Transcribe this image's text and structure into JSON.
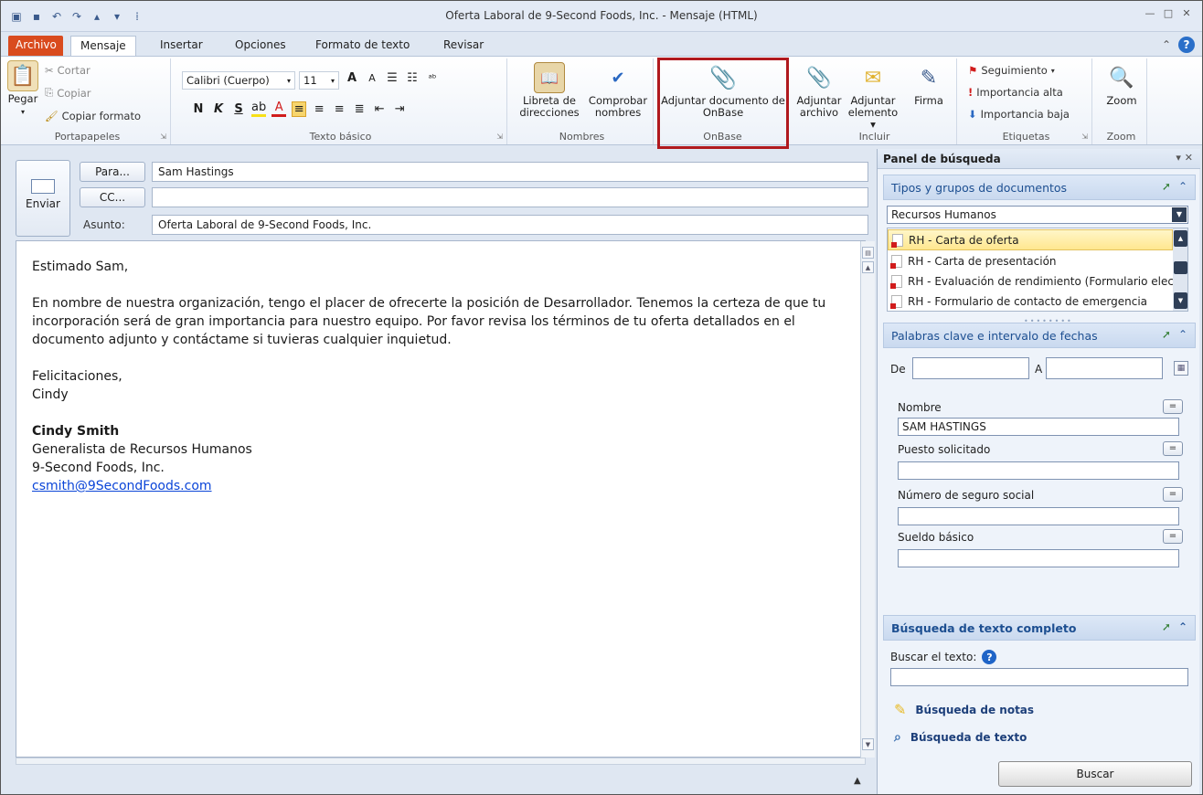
{
  "window": {
    "title": "Oferta Laboral de 9-Second Foods, Inc. - Mensaje (HTML)"
  },
  "tabs": [
    {
      "label": "Archivo"
    },
    {
      "label": "Mensaje"
    },
    {
      "label": "Insertar"
    },
    {
      "label": "Opciones"
    },
    {
      "label": "Formato de texto"
    },
    {
      "label": "Revisar"
    }
  ],
  "ribbon": {
    "portapapeles": {
      "label": "Portapapeles",
      "paste": "Pegar",
      "cut": "Cortar",
      "copy": "Copiar",
      "format_painter": "Copiar formato"
    },
    "texto_basico": {
      "label": "Texto básico",
      "font": "Calibri (Cuerpo)",
      "size": "11",
      "bold": "N",
      "italic": "K",
      "underline": "S"
    },
    "nombres": {
      "label": "Nombres",
      "address_book": "Libreta de direcciones",
      "check_names": "Comprobar nombres"
    },
    "onbase": {
      "label": "OnBase",
      "attach": "Adjuntar documento de OnBase"
    },
    "incluir": {
      "label": "Incluir",
      "attach_file": "Adjuntar archivo",
      "attach_item": "Adjuntar elemento",
      "signature": "Firma"
    },
    "etiquetas": {
      "label": "Etiquetas",
      "followup": "Seguimiento",
      "high": "Importancia alta",
      "low": "Importancia baja"
    },
    "zoom": {
      "label": "Zoom",
      "button": "Zoom"
    }
  },
  "compose": {
    "send": "Enviar",
    "to_button": "Para...",
    "to_value": "Sam Hastings",
    "cc_button": "CC...",
    "cc_value": "",
    "subject_label": "Asunto:",
    "subject_value": "Oferta Laboral de 9-Second Foods, Inc.",
    "body": {
      "greeting": "Estimado Sam,",
      "paragraph": "En nombre de nuestra organización, tengo el placer de ofrecerte la posición de Desarrollador. Tenemos la certeza de que tu incorporación será de gran importancia para nuestro equipo. Por favor revisa los términos de tu oferta detallados en el documento adjunto y contáctame si tuvieras cualquier inquietud.",
      "closing": "Felicitaciones,",
      "closing_name": "Cindy",
      "sig_name": "Cindy Smith",
      "sig_title": "Generalista de Recursos Humanos",
      "sig_company": "9-Second Foods, Inc.",
      "sig_email": "csmith@9SecondFoods.com"
    }
  },
  "panel": {
    "title": "Panel de búsqueda",
    "doc_types_section": "Tipos y grupos de documentos",
    "doc_group": "Recursos Humanos",
    "documents": [
      {
        "label": "RH - Carta de oferta",
        "selected": true
      },
      {
        "label": "RH - Carta de presentación",
        "selected": false
      },
      {
        "label": "RH - Evaluación de rendimiento (Formulario elec",
        "selected": false
      },
      {
        "label": "RH - Formulario de contacto de emergencia",
        "selected": false
      }
    ],
    "keywords_section": "Palabras clave e intervalo de fechas",
    "from_label": "De",
    "to_label": "A",
    "from_value": "",
    "to_value": "",
    "fields": [
      {
        "label": "Nombre",
        "value": "SAM HASTINGS"
      },
      {
        "label": "Puesto solicitado",
        "value": ""
      },
      {
        "label": "Número de seguro social",
        "value": ""
      },
      {
        "label": "Sueldo básico",
        "value": ""
      }
    ],
    "eq_symbol": "=",
    "fulltext_section": "Búsqueda de texto completo",
    "search_text_label": "Buscar el texto:",
    "search_text_value": "",
    "notes_search": "Búsqueda de notas",
    "text_search": "Búsqueda de texto",
    "search_button": "Buscar"
  },
  "colors": {
    "archivo_tab": "#d94b1e",
    "highlight": "#b0191e",
    "link": "#0b45d8",
    "section_text": "#1d4f91"
  }
}
